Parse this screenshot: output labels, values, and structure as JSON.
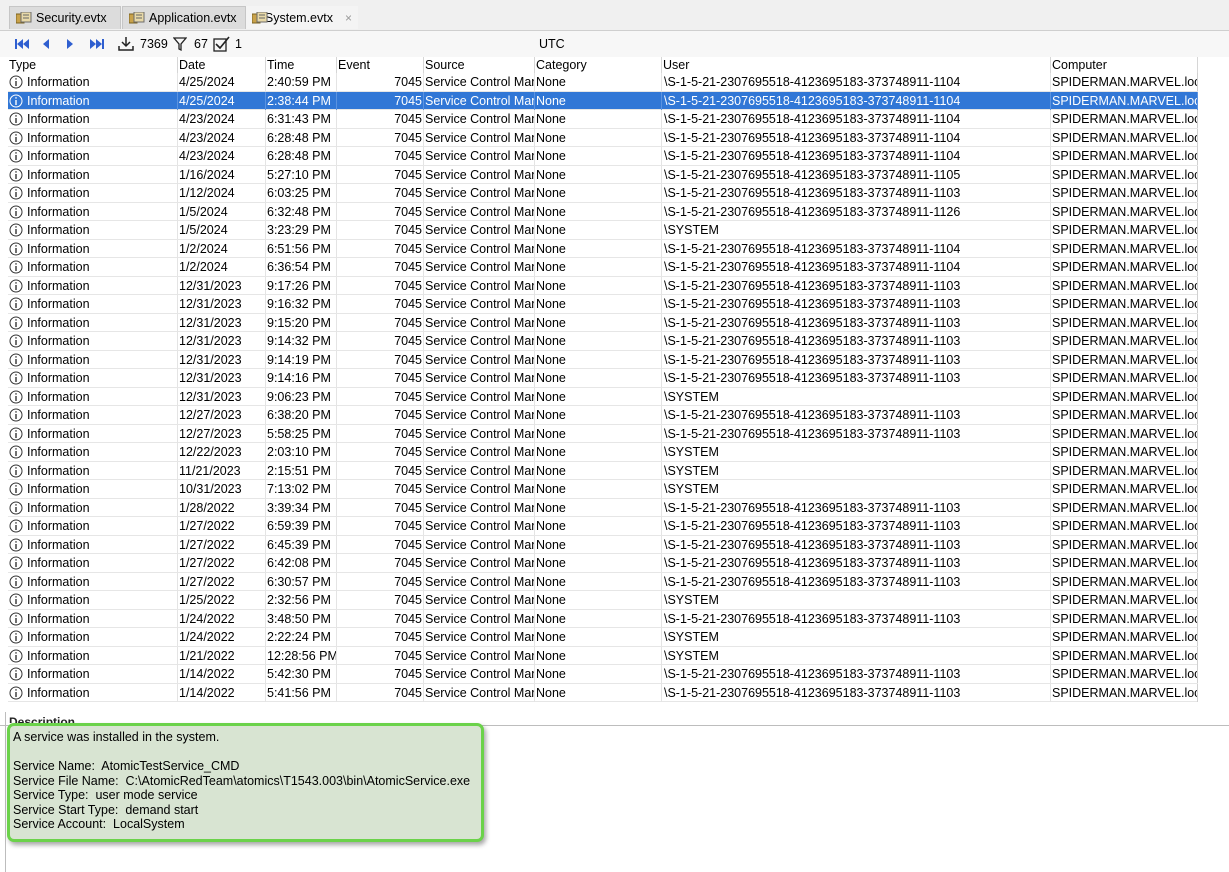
{
  "tabs": [
    {
      "label": "Security.evtx",
      "icon": "event-log-icon"
    },
    {
      "label": "Application.evtx",
      "icon": "event-log-icon"
    },
    {
      "label": "System.evtx",
      "icon": "event-log-icon",
      "close": "×"
    }
  ],
  "toolbar": {
    "count_loaded": "7369",
    "count_filtered": "67",
    "count_checked": "1",
    "timezone": "UTC"
  },
  "columns": [
    "Type",
    "Date",
    "Time",
    "Event",
    "Source",
    "Category",
    "User",
    "Computer"
  ],
  "rows": [
    {
      "type": "Information",
      "date": "4/25/2024",
      "time": "2:40:59 PM",
      "event": "7045",
      "source": "Service Control Mana",
      "category": "None",
      "user": "\\S-1-5-21-2307695518-4123695183-373748911-1104",
      "computer": "SPIDERMAN.MARVEL.local"
    },
    {
      "type": "Information",
      "date": "4/25/2024",
      "time": "2:38:44 PM",
      "event": "7045",
      "source": "Service Control Mana",
      "category": "None",
      "user": "\\S-1-5-21-2307695518-4123695183-373748911-1104",
      "computer": "SPIDERMAN.MARVEL.local",
      "selected": true
    },
    {
      "type": "Information",
      "date": "4/23/2024",
      "time": "6:31:43 PM",
      "event": "7045",
      "source": "Service Control Mana",
      "category": "None",
      "user": "\\S-1-5-21-2307695518-4123695183-373748911-1104",
      "computer": "SPIDERMAN.MARVEL.local"
    },
    {
      "type": "Information",
      "date": "4/23/2024",
      "time": "6:28:48 PM",
      "event": "7045",
      "source": "Service Control Mana",
      "category": "None",
      "user": "\\S-1-5-21-2307695518-4123695183-373748911-1104",
      "computer": "SPIDERMAN.MARVEL.local"
    },
    {
      "type": "Information",
      "date": "4/23/2024",
      "time": "6:28:48 PM",
      "event": "7045",
      "source": "Service Control Mana",
      "category": "None",
      "user": "\\S-1-5-21-2307695518-4123695183-373748911-1104",
      "computer": "SPIDERMAN.MARVEL.local"
    },
    {
      "type": "Information",
      "date": "1/16/2024",
      "time": "5:27:10 PM",
      "event": "7045",
      "source": "Service Control Mana",
      "category": "None",
      "user": "\\S-1-5-21-2307695518-4123695183-373748911-1105",
      "computer": "SPIDERMAN.MARVEL.local"
    },
    {
      "type": "Information",
      "date": "1/12/2024",
      "time": "6:03:25 PM",
      "event": "7045",
      "source": "Service Control Mana",
      "category": "None",
      "user": "\\S-1-5-21-2307695518-4123695183-373748911-1103",
      "computer": "SPIDERMAN.MARVEL.local"
    },
    {
      "type": "Information",
      "date": "1/5/2024",
      "time": "6:32:48 PM",
      "event": "7045",
      "source": "Service Control Mana",
      "category": "None",
      "user": "\\S-1-5-21-2307695518-4123695183-373748911-1126",
      "computer": "SPIDERMAN.MARVEL.local"
    },
    {
      "type": "Information",
      "date": "1/5/2024",
      "time": "3:23:29 PM",
      "event": "7045",
      "source": "Service Control Mana",
      "category": "None",
      "user": "\\SYSTEM",
      "computer": "SPIDERMAN.MARVEL.local"
    },
    {
      "type": "Information",
      "date": "1/2/2024",
      "time": "6:51:56 PM",
      "event": "7045",
      "source": "Service Control Mana",
      "category": "None",
      "user": "\\S-1-5-21-2307695518-4123695183-373748911-1104",
      "computer": "SPIDERMAN.MARVEL.local"
    },
    {
      "type": "Information",
      "date": "1/2/2024",
      "time": "6:36:54 PM",
      "event": "7045",
      "source": "Service Control Mana",
      "category": "None",
      "user": "\\S-1-5-21-2307695518-4123695183-373748911-1104",
      "computer": "SPIDERMAN.MARVEL.local"
    },
    {
      "type": "Information",
      "date": "12/31/2023",
      "time": "9:17:26 PM",
      "event": "7045",
      "source": "Service Control Mana",
      "category": "None",
      "user": "\\S-1-5-21-2307695518-4123695183-373748911-1103",
      "computer": "SPIDERMAN.MARVEL.local"
    },
    {
      "type": "Information",
      "date": "12/31/2023",
      "time": "9:16:32 PM",
      "event": "7045",
      "source": "Service Control Mana",
      "category": "None",
      "user": "\\S-1-5-21-2307695518-4123695183-373748911-1103",
      "computer": "SPIDERMAN.MARVEL.local"
    },
    {
      "type": "Information",
      "date": "12/31/2023",
      "time": "9:15:20 PM",
      "event": "7045",
      "source": "Service Control Mana",
      "category": "None",
      "user": "\\S-1-5-21-2307695518-4123695183-373748911-1103",
      "computer": "SPIDERMAN.MARVEL.local"
    },
    {
      "type": "Information",
      "date": "12/31/2023",
      "time": "9:14:32 PM",
      "event": "7045",
      "source": "Service Control Mana",
      "category": "None",
      "user": "\\S-1-5-21-2307695518-4123695183-373748911-1103",
      "computer": "SPIDERMAN.MARVEL.local"
    },
    {
      "type": "Information",
      "date": "12/31/2023",
      "time": "9:14:19 PM",
      "event": "7045",
      "source": "Service Control Mana",
      "category": "None",
      "user": "\\S-1-5-21-2307695518-4123695183-373748911-1103",
      "computer": "SPIDERMAN.MARVEL.local"
    },
    {
      "type": "Information",
      "date": "12/31/2023",
      "time": "9:14:16 PM",
      "event": "7045",
      "source": "Service Control Mana",
      "category": "None",
      "user": "\\S-1-5-21-2307695518-4123695183-373748911-1103",
      "computer": "SPIDERMAN.MARVEL.local"
    },
    {
      "type": "Information",
      "date": "12/31/2023",
      "time": "9:06:23 PM",
      "event": "7045",
      "source": "Service Control Mana",
      "category": "None",
      "user": "\\SYSTEM",
      "computer": "SPIDERMAN.MARVEL.local"
    },
    {
      "type": "Information",
      "date": "12/27/2023",
      "time": "6:38:20 PM",
      "event": "7045",
      "source": "Service Control Mana",
      "category": "None",
      "user": "\\S-1-5-21-2307695518-4123695183-373748911-1103",
      "computer": "SPIDERMAN.MARVEL.local"
    },
    {
      "type": "Information",
      "date": "12/27/2023",
      "time": "5:58:25 PM",
      "event": "7045",
      "source": "Service Control Mana",
      "category": "None",
      "user": "\\S-1-5-21-2307695518-4123695183-373748911-1103",
      "computer": "SPIDERMAN.MARVEL.local"
    },
    {
      "type": "Information",
      "date": "12/22/2023",
      "time": "2:03:10 PM",
      "event": "7045",
      "source": "Service Control Mana",
      "category": "None",
      "user": "\\SYSTEM",
      "computer": "SPIDERMAN.MARVEL.local"
    },
    {
      "type": "Information",
      "date": "11/21/2023",
      "time": "2:15:51 PM",
      "event": "7045",
      "source": "Service Control Mana",
      "category": "None",
      "user": "\\SYSTEM",
      "computer": "SPIDERMAN.MARVEL.local"
    },
    {
      "type": "Information",
      "date": "10/31/2023",
      "time": "7:13:02 PM",
      "event": "7045",
      "source": "Service Control Mana",
      "category": "None",
      "user": "\\SYSTEM",
      "computer": "SPIDERMAN.MARVEL.local"
    },
    {
      "type": "Information",
      "date": "1/28/2022",
      "time": "3:39:34 PM",
      "event": "7045",
      "source": "Service Control Mana",
      "category": "None",
      "user": "\\S-1-5-21-2307695518-4123695183-373748911-1103",
      "computer": "SPIDERMAN.MARVEL.local"
    },
    {
      "type": "Information",
      "date": "1/27/2022",
      "time": "6:59:39 PM",
      "event": "7045",
      "source": "Service Control Mana",
      "category": "None",
      "user": "\\S-1-5-21-2307695518-4123695183-373748911-1103",
      "computer": "SPIDERMAN.MARVEL.local"
    },
    {
      "type": "Information",
      "date": "1/27/2022",
      "time": "6:45:39 PM",
      "event": "7045",
      "source": "Service Control Mana",
      "category": "None",
      "user": "\\S-1-5-21-2307695518-4123695183-373748911-1103",
      "computer": "SPIDERMAN.MARVEL.local"
    },
    {
      "type": "Information",
      "date": "1/27/2022",
      "time": "6:42:08 PM",
      "event": "7045",
      "source": "Service Control Mana",
      "category": "None",
      "user": "\\S-1-5-21-2307695518-4123695183-373748911-1103",
      "computer": "SPIDERMAN.MARVEL.local"
    },
    {
      "type": "Information",
      "date": "1/27/2022",
      "time": "6:30:57 PM",
      "event": "7045",
      "source": "Service Control Mana",
      "category": "None",
      "user": "\\S-1-5-21-2307695518-4123695183-373748911-1103",
      "computer": "SPIDERMAN.MARVEL.local"
    },
    {
      "type": "Information",
      "date": "1/25/2022",
      "time": "2:32:56 PM",
      "event": "7045",
      "source": "Service Control Mana",
      "category": "None",
      "user": "\\SYSTEM",
      "computer": "SPIDERMAN.MARVEL.local"
    },
    {
      "type": "Information",
      "date": "1/24/2022",
      "time": "3:48:50 PM",
      "event": "7045",
      "source": "Service Control Mana",
      "category": "None",
      "user": "\\S-1-5-21-2307695518-4123695183-373748911-1103",
      "computer": "SPIDERMAN.MARVEL.local"
    },
    {
      "type": "Information",
      "date": "1/24/2022",
      "time": "2:22:24 PM",
      "event": "7045",
      "source": "Service Control Mana",
      "category": "None",
      "user": "\\SYSTEM",
      "computer": "SPIDERMAN.MARVEL.local"
    },
    {
      "type": "Information",
      "date": "1/21/2022",
      "time": "12:28:56 PM",
      "event": "7045",
      "source": "Service Control Mana",
      "category": "None",
      "user": "\\SYSTEM",
      "computer": "SPIDERMAN.MARVEL.local"
    },
    {
      "type": "Information",
      "date": "1/14/2022",
      "time": "5:42:30 PM",
      "event": "7045",
      "source": "Service Control Mana",
      "category": "None",
      "user": "\\S-1-5-21-2307695518-4123695183-373748911-1103",
      "computer": "SPIDERMAN.MARVEL.local"
    },
    {
      "type": "Information",
      "date": "1/14/2022",
      "time": "5:41:56 PM",
      "event": "7045",
      "source": "Service Control Mana",
      "category": "None",
      "user": "\\S-1-5-21-2307695518-4123695183-373748911-1103",
      "computer": "SPIDERMAN.MARVEL.local"
    }
  ],
  "description": {
    "title": "Description",
    "lines": [
      "A service was installed in the system.",
      "",
      "Service Name:  AtomicTestService_CMD",
      "Service File Name:  C:\\AtomicRedTeam\\atomics\\T1543.003\\bin\\AtomicService.exe",
      "Service Type:  user mode service",
      "Service Start Type:  demand start",
      "Service Account:  LocalSystem"
    ]
  },
  "colors": {
    "selection": "#3177d6",
    "highlight_border": "#6bd24a",
    "highlight_fill": "#d8e4d2",
    "nav_arrow": "#2f5fd0"
  }
}
